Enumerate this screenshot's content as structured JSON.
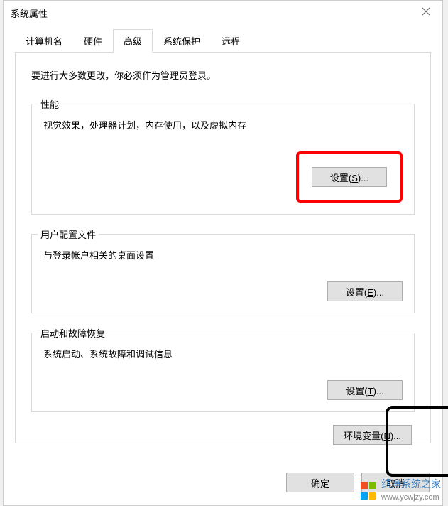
{
  "window": {
    "title": "系统属性"
  },
  "tabs": {
    "computer_name": "计算机名",
    "hardware": "硬件",
    "advanced": "高级",
    "system_protection": "系统保护",
    "remote": "远程"
  },
  "panel": {
    "admin_note": "要进行大多数更改，你必须作为管理员登录。",
    "performance": {
      "legend": "性能",
      "desc": "视觉效果，处理器计划，内存使用，以及虚拟内存",
      "btn_prefix": "设置(",
      "btn_key": "S",
      "btn_suffix": ")..."
    },
    "user_profiles": {
      "legend": "用户配置文件",
      "desc": "与登录帐户相关的桌面设置",
      "btn_prefix": "设置(",
      "btn_key": "E",
      "btn_suffix": ")..."
    },
    "startup": {
      "legend": "启动和故障恢复",
      "desc": "系统启动、系统故障和调试信息",
      "btn_prefix": "设置(",
      "btn_key": "T",
      "btn_suffix": ")..."
    },
    "env_prefix": "环境变量(",
    "env_key": "N",
    "env_suffix": ")..."
  },
  "footer": {
    "ok": "确定",
    "cancel": "取消"
  },
  "watermark": {
    "text": "纯净系统之家",
    "url": "www.ycwjzy.com"
  }
}
